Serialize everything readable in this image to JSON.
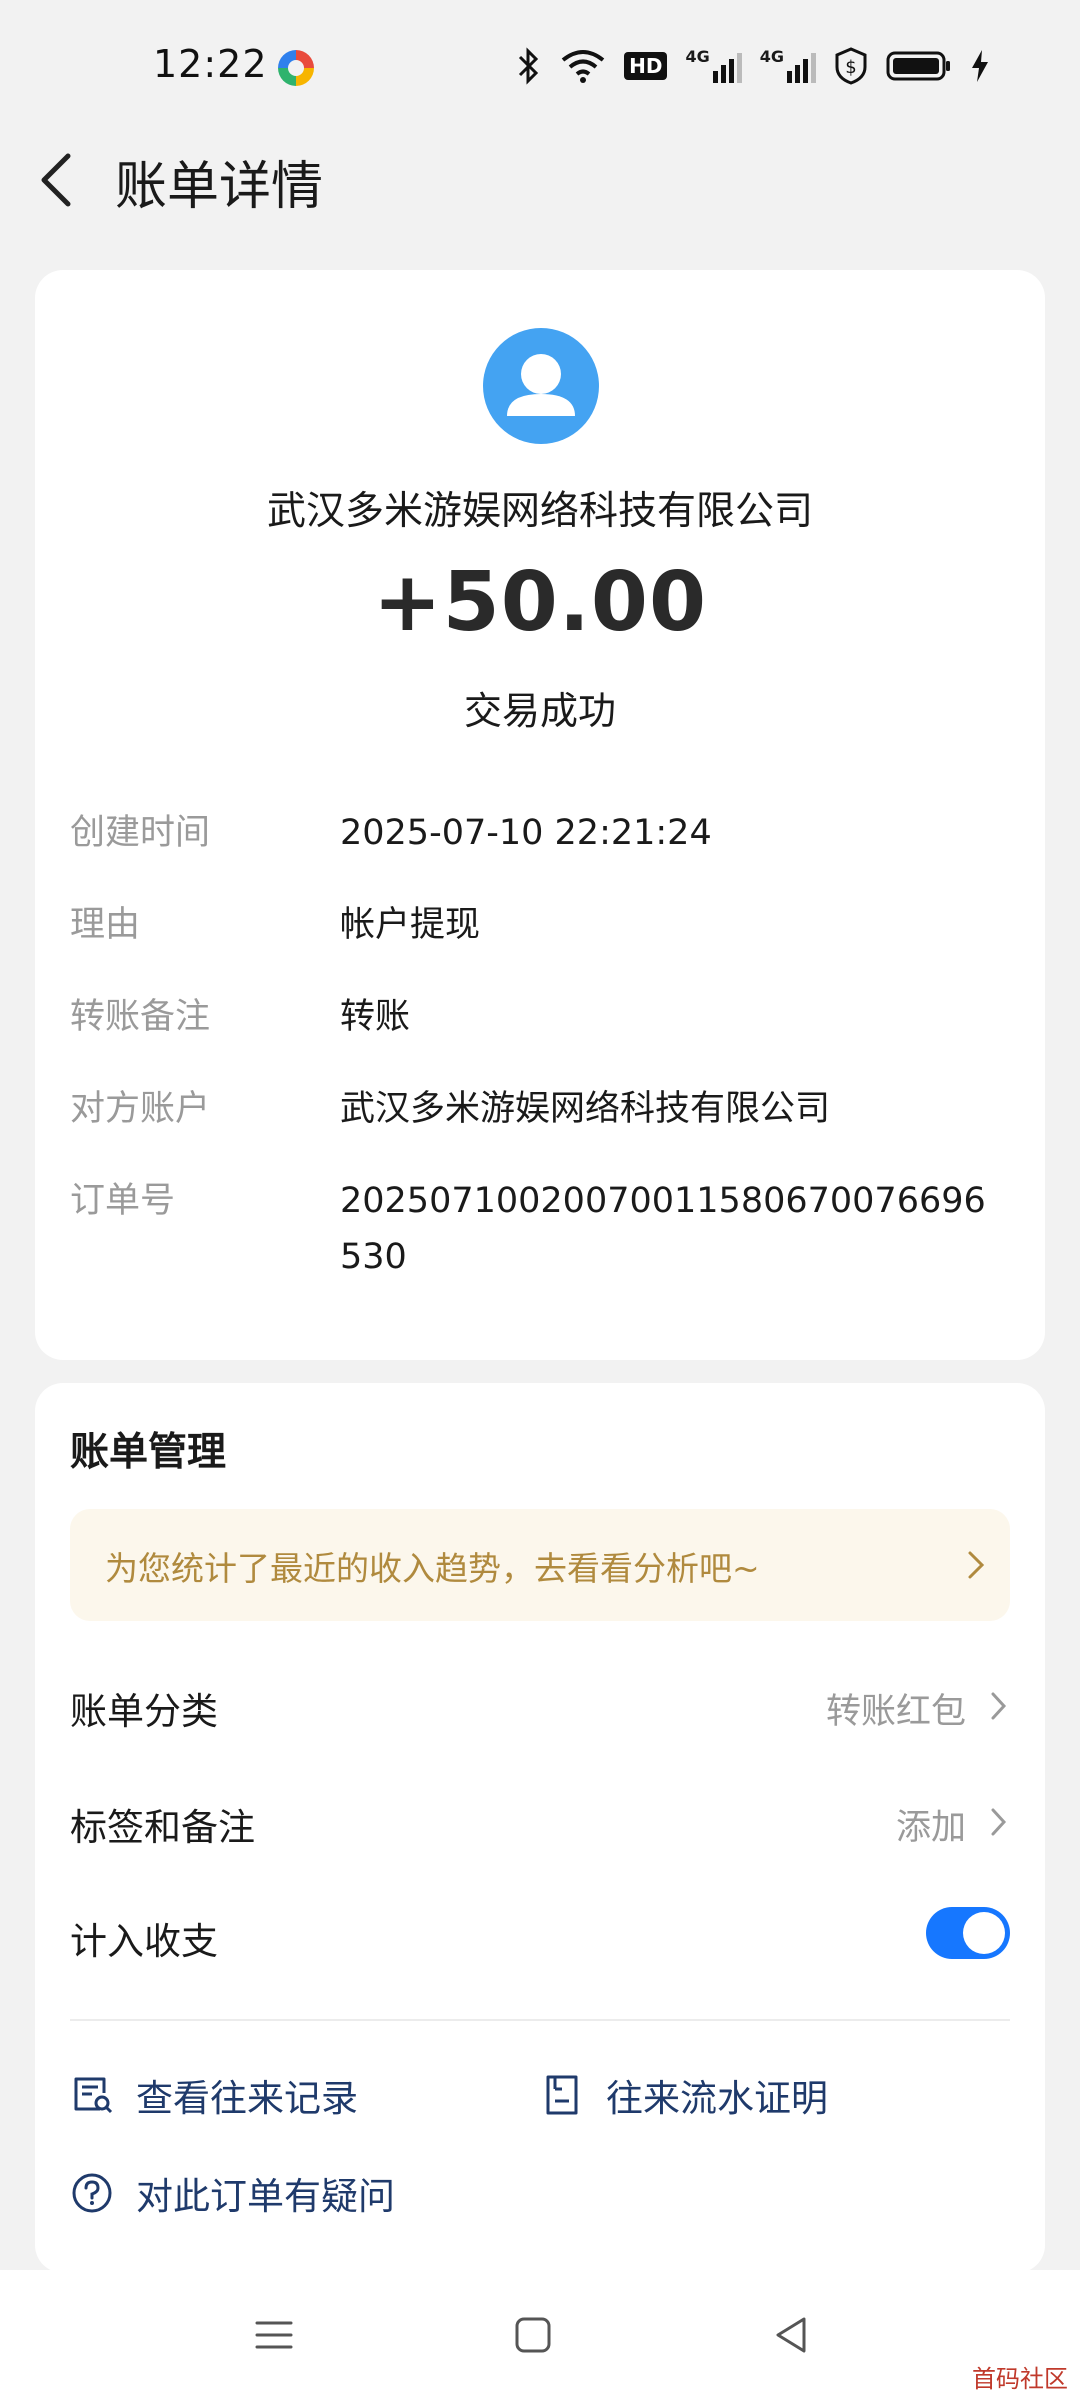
{
  "status_bar": {
    "time": "12:22",
    "network_1": "4G",
    "network_2": "4G",
    "hd_badge": "HD"
  },
  "header": {
    "back_icon": "chevron-left-icon",
    "title": "账单详情"
  },
  "transaction": {
    "avatar_icon": "user-avatar-icon",
    "merchant": "武汉多米游娱网络科技有限公司",
    "amount": "+50.00",
    "status": "交易成功"
  },
  "details": [
    {
      "label": "创建时间",
      "value": "2025-07-10 22:21:24"
    },
    {
      "label": "理由",
      "value": "帐户提现"
    },
    {
      "label": "转账备注",
      "value": "转账"
    },
    {
      "label": "对方账户",
      "value": "武汉多米游娱网络科技有限公司"
    },
    {
      "label": "订单号",
      "value": "20250710020070011580670076696530"
    }
  ],
  "management": {
    "title": "账单管理",
    "tip": "为您统计了最近的收入趋势，去看看分析吧~",
    "category_label": "账单分类",
    "category_value": "转账红包",
    "tags_label": "标签和备注",
    "tags_value": "添加",
    "include_label": "计入收支",
    "include_enabled": true,
    "links": {
      "history": "查看往来记录",
      "statement": "往来流水证明",
      "question": "对此订单有疑问"
    }
  },
  "colors": {
    "accent": "#1677ff",
    "avatar": "#44a3f2",
    "tip_text": "#b08a3e",
    "tip_bg": "#fcf7ec",
    "link": "#1f3a6b"
  },
  "watermark": "首码社区"
}
